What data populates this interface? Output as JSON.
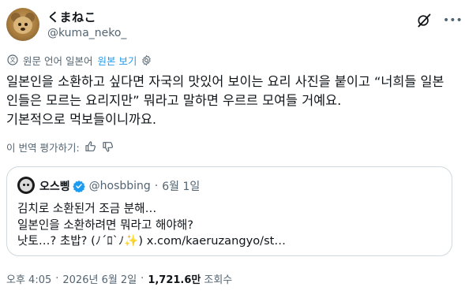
{
  "author": {
    "display_name": "くまねこ",
    "handle": "@kuma_neko_"
  },
  "translation": {
    "label": "원문 언어 일본어",
    "show_original": "원본 보기"
  },
  "tweet": {
    "lines": [
      "일본인을 소환하고 싶다면 자국의 맛있어 보이는 요리 사진을 붙이고 “너희들 일본",
      "인들은 모르는 요리지만” 뭐라고 말하면 우르르 모여들 거예요.",
      "기본적으로 먹보들이니까요."
    ]
  },
  "rate_translation": "이 번역 평가하기:",
  "quote": {
    "name": "오스삥",
    "handle": "@hosbbing",
    "date": "6월 1일",
    "lines": [
      "김치로 소환된거 조금 분해…",
      "일본인을 소환하려면 뭐라고 해야해?",
      "낫토…? 초밥? (ﾉ´ﾛ`ﾉ✨) x.com/kaeruzangyo/st…"
    ]
  },
  "meta": {
    "time": "오후 4:05",
    "date": "2026년 6월 2일",
    "views": "1,721.6만",
    "views_label": "조회수"
  },
  "colors": {
    "accent": "#1d9bf0",
    "text": "#0f1419",
    "secondary": "#536471",
    "border": "#cfd9de"
  },
  "icons": [
    "grok-icon",
    "more-icon",
    "translate-icon",
    "gear-icon",
    "thumbs-up-icon",
    "thumbs-down-icon",
    "verified-icon"
  ]
}
